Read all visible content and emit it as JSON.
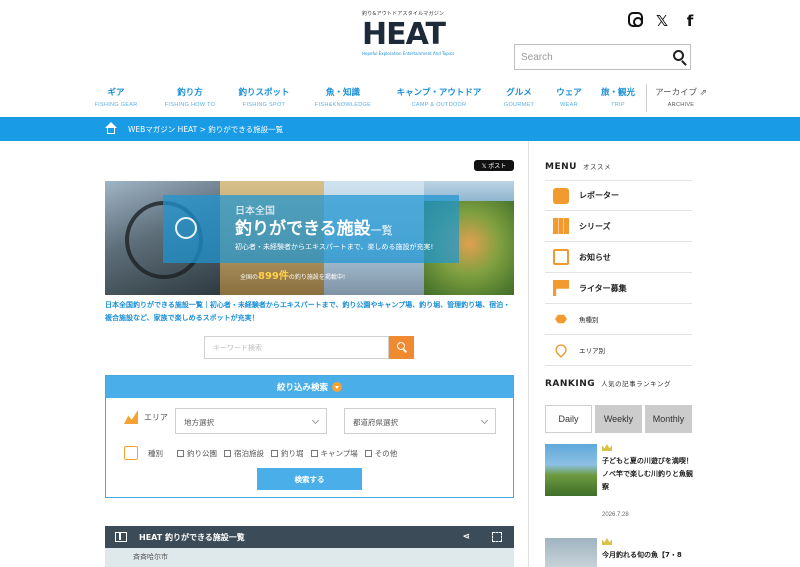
{
  "site": {
    "tagline": "釣り&アウトドアスタイルマガジン",
    "logo_text": "HEAT",
    "logo_sub": "Hopeful Exploration Entertainment And Topics"
  },
  "social": {
    "icons": [
      "instagram-icon",
      "x-icon",
      "facebook-icon"
    ],
    "x_glyph": "𝕏",
    "fb_glyph": "f"
  },
  "search": {
    "placeholder": "Search"
  },
  "nav": [
    {
      "jp": "ギア",
      "en": "FISHING GEAR"
    },
    {
      "jp": "釣り方",
      "en": "FISHING HOW TO"
    },
    {
      "jp": "釣りスポット",
      "en": "FISHING SPOT"
    },
    {
      "jp": "魚・知識",
      "en": "FISH&KNOWLEDGE"
    },
    {
      "jp": "キャンプ・アウトドア",
      "en": "CAMP & OUTDOOR"
    },
    {
      "jp": "グルメ",
      "en": "GOURMET"
    },
    {
      "jp": "ウェア",
      "en": "WEAR"
    },
    {
      "jp": "旅・観光",
      "en": "TRIP"
    },
    {
      "jp": "アーカイブ ⇗",
      "en": "ARCHIVE"
    }
  ],
  "breadcrumb": "WEBマガジン HEAT > 釣りができる施設一覧",
  "x_post_label": "𝕏 ポスト",
  "hero": {
    "line1": "日本全国",
    "title": "釣りができる施設",
    "title_suffix": "一覧",
    "line2": "初心者・未経験者からエキスパートまで、楽しめる施設が充実!",
    "count_prefix": "全国の",
    "count": "899件",
    "count_suffix": "の釣り施設を掲載中!"
  },
  "intro": "日本全国釣りができる施設一覧｜初心者・未経験者からエキスパートまで、釣り公園やキャンプ場、釣り堀、管理釣り場、宿泊・複合施設など、家族で楽しめるスポットが充実！",
  "keyword_search": {
    "placeholder": "キーワード検索"
  },
  "filter": {
    "title": "絞り込み検索",
    "area_label": "エリア",
    "region_select": "地方選択",
    "prefecture_select": "都道府県選択",
    "type_label": "種別",
    "types": [
      "釣り公園",
      "宿泊施設",
      "釣り堀",
      "キャンプ場",
      "その他"
    ],
    "submit": "検索する"
  },
  "map": {
    "title": "HEAT 釣りができる施設一覧",
    "share_glyph": "⋖",
    "city": "斉斉哈尔市"
  },
  "sidebar": {
    "menu_title": "MENU",
    "menu_sub": "オススメ",
    "menu": [
      {
        "label": "レポーター",
        "icon": "reporter-icon"
      },
      {
        "label": "シリーズ",
        "icon": "series-icon"
      },
      {
        "label": "お知らせ",
        "icon": "news-icon"
      },
      {
        "label": "ライター募集",
        "icon": "flag-icon"
      },
      {
        "label": "魚種別",
        "icon": "fish-icon"
      },
      {
        "label": "エリア別",
        "icon": "map-pin-icon"
      }
    ],
    "ranking_title": "RANKING",
    "ranking_sub": "人気の記事ランキング",
    "tabs": [
      "Daily",
      "Weekly",
      "Monthly"
    ],
    "active_tab": "Daily",
    "articles": [
      {
        "title": "子どもと夏の川遊びを満喫！ノベ竿で楽しむ川釣りと魚観察",
        "date": "2026.7.28"
      },
      {
        "title": "今月釣れる旬の魚【7・8",
        "date": ""
      }
    ]
  },
  "colors": {
    "accent": "#1a9be6",
    "orange": "#f39a2e",
    "filter_blue": "#4aaee8"
  }
}
